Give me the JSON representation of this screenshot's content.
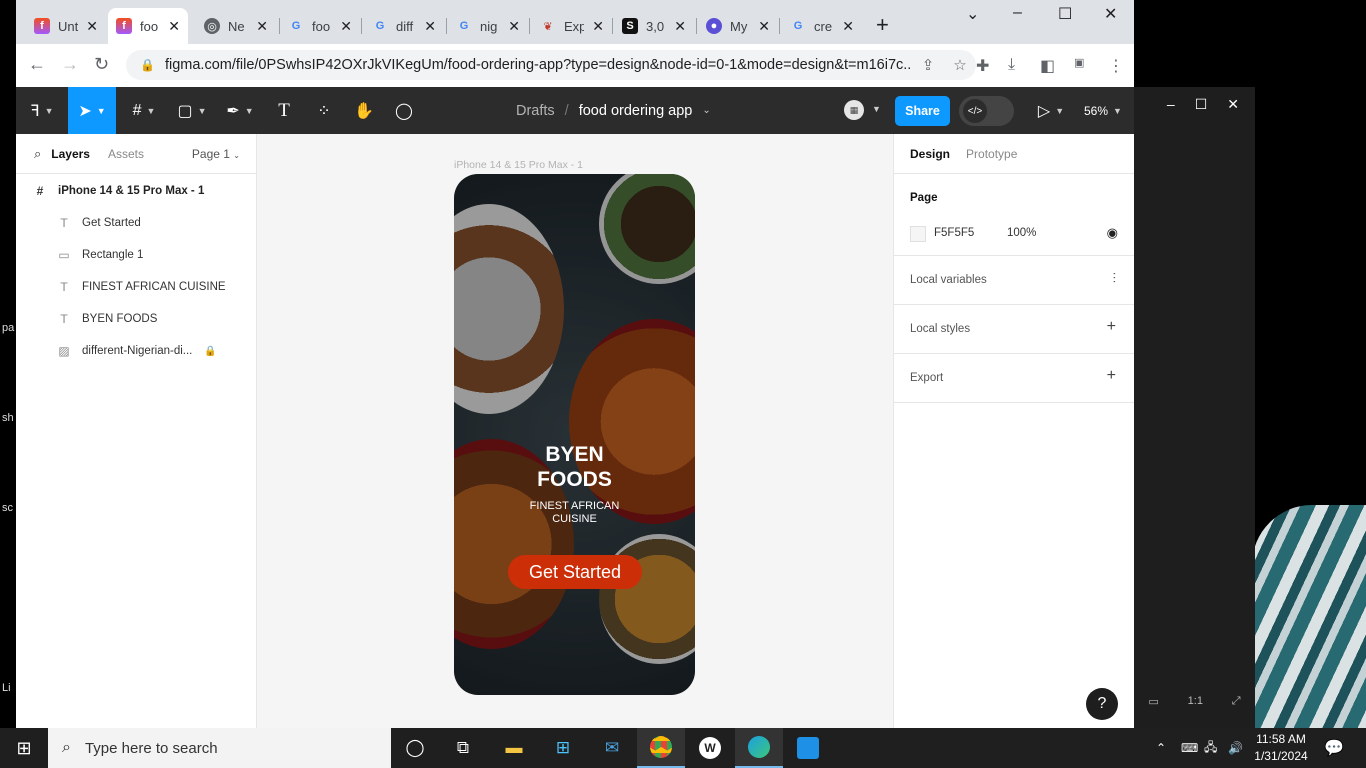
{
  "browser": {
    "tabs": [
      {
        "title": "Unt",
        "favicon": "figma"
      },
      {
        "title": "foo",
        "favicon": "figma"
      },
      {
        "title": "Ne",
        "favicon": "chrome"
      },
      {
        "title": "foo",
        "favicon": "google"
      },
      {
        "title": "diff",
        "favicon": "google"
      },
      {
        "title": "nig",
        "favicon": "google"
      },
      {
        "title": "Exp",
        "favicon": "extension"
      },
      {
        "title": "3,0",
        "favicon": "shutterstock"
      },
      {
        "title": "My",
        "favicon": "app"
      },
      {
        "title": "cre",
        "favicon": "google"
      }
    ],
    "url": "figma.com/file/0PSwhsIP42OXrJkVIKegUm/food-ordering-app?type=design&node-id=0-1&mode=design&t=m16i7c..."
  },
  "figma": {
    "breadcrumb": {
      "drafts": "Drafts",
      "separator": "/",
      "file_name": "food ordering app"
    },
    "share_label": "Share",
    "zoom": "56%",
    "left_panel": {
      "tab_layers": "Layers",
      "tab_assets": "Assets",
      "page_selector": "Page 1",
      "layers": [
        {
          "name": "iPhone 14 & 15 Pro Max - 1",
          "icon": "frame-icon"
        },
        {
          "name": "Get Started",
          "icon": "text-icon"
        },
        {
          "name": "Rectangle 1",
          "icon": "rectangle-icon"
        },
        {
          "name": "FINEST AFRICAN CUISINE",
          "icon": "text-icon"
        },
        {
          "name": "BYEN FOODS",
          "icon": "text-icon"
        },
        {
          "name": "different-Nigerian-di...",
          "icon": "image-icon",
          "locked": true
        }
      ]
    },
    "canvas": {
      "frame_label": "iPhone 14 & 15 Pro Max - 1",
      "title_line1": "BYEN",
      "title_line2": "FOODS",
      "subtitle": "FINEST AFRICAN CUISINE",
      "button_label": "Get Started",
      "button_color": "#cc2f08"
    },
    "right_panel": {
      "tab_design": "Design",
      "tab_prototype": "Prototype",
      "page_label": "Page",
      "page_color": "F5F5F5",
      "page_opacity": "100%",
      "local_variables": "Local variables",
      "local_styles": "Local styles",
      "export": "Export"
    }
  },
  "taskbar": {
    "search_placeholder": "Type here to search",
    "time": "11:58 AM",
    "date": "1/31/2024"
  },
  "desktop": {
    "left_edge_fragments": [
      "pa",
      "sh",
      "sc",
      "Li"
    ]
  }
}
